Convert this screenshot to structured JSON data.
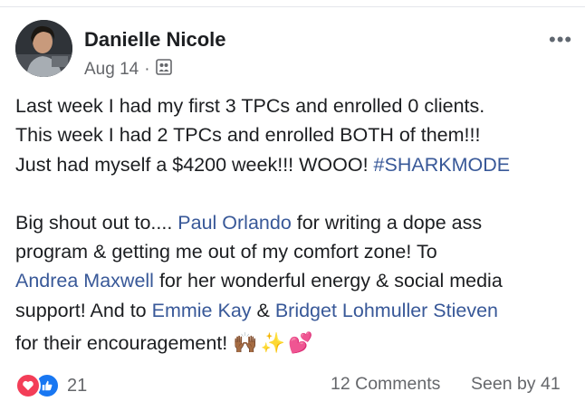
{
  "post": {
    "author": "Danielle Nicole",
    "date": "Aug 14",
    "separator": "·",
    "more_label": "•••",
    "lines": {
      "l1": "Last week I had my first 3 TPCs and enrolled 0 clients.",
      "l2": "This week I had 2 TPCs and enrolled BOTH of them!!!",
      "l3_text": "Just had myself a $4200 week!!! WOOO! ",
      "l3_tag": "#SHARKMODE",
      "l4_pre": "Big shout out to.... ",
      "l4_link": "Paul Orlando",
      "l4_post": " for writing a dope ass",
      "l5": "program & getting me out of my comfort zone! To",
      "l6_link": "Andrea Maxwell",
      "l6_post": " for her wonderful energy & social media",
      "l7_pre": "support! And to ",
      "l7_link1": "Emmie Kay",
      "l7_mid": " & ",
      "l7_link2": "Bridget Lohmuller Stieven",
      "l8_text": "for their encouragement!",
      "l8_emojis": "🙌🏾✨💕"
    }
  },
  "footer": {
    "reaction_count": "21",
    "comments": "12 Comments",
    "seen": "Seen by 41"
  },
  "colors": {
    "link": "#385898",
    "secondary": "#65676b",
    "love": "#f33e58",
    "like": "#1877f2"
  },
  "icons": {
    "privacy": "group-icon",
    "more": "more-options-icon",
    "love": "love-reaction-icon",
    "like": "like-reaction-icon"
  }
}
